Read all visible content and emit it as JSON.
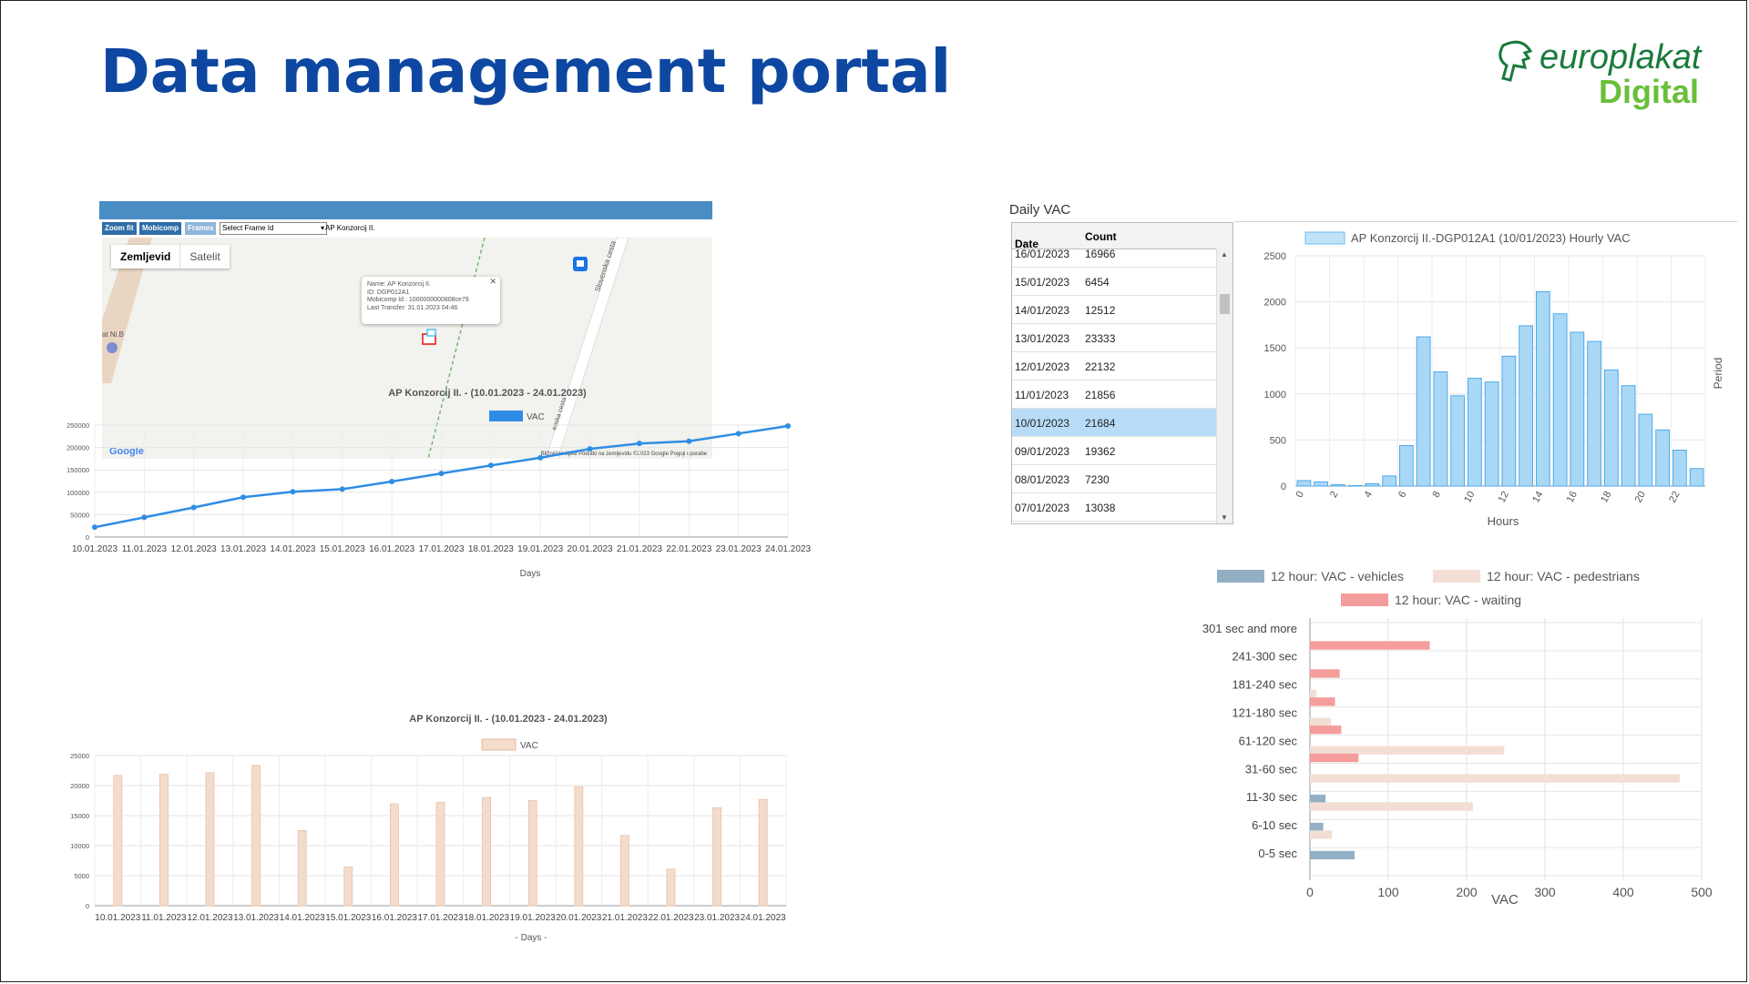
{
  "page": {
    "title": "Data management portal",
    "logo_line1": "europlakat",
    "logo_line2": "Digital"
  },
  "map": {
    "buttons": [
      "Zoom fit",
      "Mobicomp",
      "Frames"
    ],
    "frame_select_placeholder": "Select Frame Id",
    "location_label": "AP Konzorcij II.",
    "map_type_buttons": [
      "Zemljevid",
      "Satelit"
    ],
    "popup": {
      "name": "Name: AP Konzorcij II.",
      "id": "ID: DGP012A1",
      "mobicomp": "Mobicomp Id : 1000000000808ce79",
      "last_transfer": "Last Transfer: 31.01.2023 04:46"
    },
    "street_labels": [
      "Slovenska cesta",
      "enska cesta",
      "at Ni.B"
    ],
    "google_label": "Google",
    "footer": "Bližnjične tipke   Podatki na zemljevidu ©2023 Google   Pogoji uporabe"
  },
  "daily_vac": {
    "label": "Daily VAC",
    "columns": [
      "Date",
      "Count"
    ],
    "rows": [
      {
        "date": "16/01/2023",
        "count": "16966"
      },
      {
        "date": "15/01/2023",
        "count": "6454"
      },
      {
        "date": "14/01/2023",
        "count": "12512"
      },
      {
        "date": "13/01/2023",
        "count": "23333"
      },
      {
        "date": "12/01/2023",
        "count": "22132"
      },
      {
        "date": "11/01/2023",
        "count": "21856"
      },
      {
        "date": "10/01/2023",
        "count": "21684"
      },
      {
        "date": "09/01/2023",
        "count": "19362"
      },
      {
        "date": "08/01/2023",
        "count": "7230"
      },
      {
        "date": "07/01/2023",
        "count": "13038"
      }
    ],
    "selected_index": 6
  },
  "chart_data": [
    {
      "type": "line",
      "title": "AP Konzorcij II. -  (10.01.2023 - 24.01.2023)",
      "legend": "VAC",
      "xlabel": "Days",
      "ylabel": "",
      "ylim": [
        0,
        250000
      ],
      "yticks": [
        "0",
        "50000",
        "100000",
        "150000",
        "200000",
        "250000"
      ],
      "categories": [
        "10.01.2023",
        "11.01.2023",
        "12.01.2023",
        "13.01.2023",
        "14.01.2023",
        "15.01.2023",
        "16.01.2023",
        "17.01.2023",
        "18.01.2023",
        "19.01.2023",
        "20.01.2023",
        "21.01.2023",
        "22.01.2023",
        "23.01.2023",
        "24.01.2023"
      ],
      "values": [
        22000,
        44000,
        66000,
        89000,
        101000,
        107000,
        124000,
        142000,
        160000,
        177000,
        197000,
        209000,
        214000,
        231000,
        248000
      ],
      "color": "#2f8de4"
    },
    {
      "type": "bar",
      "title": "AP Konzorcij II. -  (10.01.2023 - 24.01.2023)",
      "legend": "VAC",
      "xlabel": "- Days -",
      "ylabel": "",
      "ylim": [
        0,
        25000
      ],
      "yticks": [
        "0",
        "5000",
        "10000",
        "15000",
        "20000",
        "25000"
      ],
      "categories": [
        "10.01.2023",
        "11.01.2023",
        "12.01.2023",
        "13.01.2023",
        "14.01.2023",
        "15.01.2023",
        "16.01.2023",
        "17.01.2023",
        "18.01.2023",
        "19.01.2023",
        "20.01.2023",
        "21.01.2023",
        "22.01.2023",
        "23.01.2023",
        "24.01.2023"
      ],
      "values": [
        21684,
        21856,
        22132,
        23333,
        12512,
        6454,
        16966,
        17200,
        18000,
        17500,
        19800,
        11700,
        6100,
        16300,
        17700
      ],
      "color": "#f4dccb"
    },
    {
      "type": "bar",
      "title": "",
      "legend": "AP Konzorcij II.-DGP012A1  (10/01/2023)  Hourly VAC",
      "xlabel": "Hours",
      "ylabel": "Period",
      "ylim": [
        0,
        2500
      ],
      "yticks": [
        "0",
        "500",
        "1000",
        "1500",
        "2000",
        "2500"
      ],
      "xticks": [
        "0",
        "2",
        "4",
        "6",
        "8",
        "10",
        "12",
        "14",
        "16",
        "18",
        "20",
        "22"
      ],
      "categories": [
        "0",
        "1",
        "2",
        "3",
        "4",
        "5",
        "6",
        "7",
        "8",
        "9",
        "10",
        "11",
        "12",
        "13",
        "14",
        "15",
        "16",
        "17",
        "18",
        "19",
        "20",
        "21",
        "22",
        "23"
      ],
      "values": [
        60,
        45,
        15,
        5,
        25,
        110,
        440,
        1620,
        1240,
        980,
        1170,
        1130,
        1410,
        1740,
        2110,
        1870,
        1670,
        1570,
        1260,
        1090,
        780,
        610,
        390,
        190
      ],
      "color": "#a9d8f7"
    },
    {
      "type": "bar",
      "orientation": "horizontal",
      "title": "",
      "xlabel": "VAC",
      "ylabel": "",
      "xlim": [
        0,
        500
      ],
      "xticks": [
        "0",
        "100",
        "200",
        "300",
        "400",
        "500"
      ],
      "categories": [
        "301 sec and more",
        "241-300 sec",
        "181-240 sec",
        "121-180 sec",
        "61-120 sec",
        "31-60 sec",
        "11-30 sec",
        "6-10 sec",
        "0-5 sec"
      ],
      "series": [
        {
          "name": "12 hour: VAC - vehicles",
          "color": "#93afc4",
          "values": [
            0,
            0,
            0,
            0,
            0,
            0,
            20,
            17,
            57
          ]
        },
        {
          "name": "12 hour: VAC - pedestrians",
          "color": "#f2ded4",
          "values": [
            0,
            0,
            8,
            27,
            248,
            472,
            208,
            28,
            0
          ]
        },
        {
          "name": "12 hour: VAC - waiting",
          "color": "#f59c9c",
          "values": [
            153,
            38,
            32,
            40,
            62,
            0,
            0,
            0,
            0
          ]
        }
      ]
    }
  ]
}
